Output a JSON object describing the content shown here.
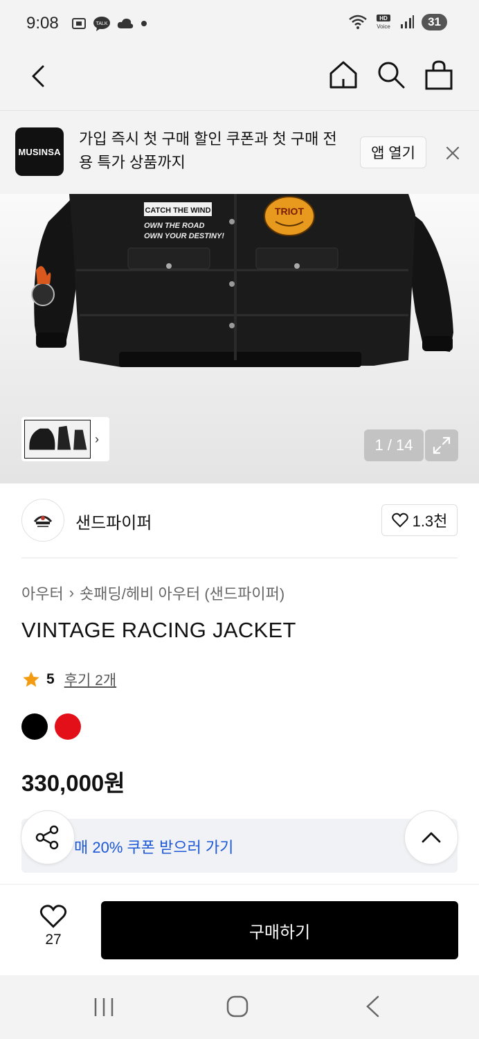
{
  "status_bar": {
    "time": "9:08",
    "battery": "31"
  },
  "banner": {
    "logo_text": "MUSINSA",
    "message": "가입 즉시 첫 구매 할인 쿠폰과 첫 구매 전용 특가 상품까지",
    "open_app_label": "앱 열기"
  },
  "gallery": {
    "counter": "1 / 14",
    "patch_text_1": "CATCH THE WIND",
    "patch_text_2": "OWN THE ROAD",
    "patch_text_3": "OWN YOUR DESTINY!",
    "patch_text_4": "TRIOT"
  },
  "brand": {
    "name": "샌드파이퍼",
    "likes": "1.3천"
  },
  "product": {
    "breadcrumb": [
      "아우터",
      "숏패딩/헤비 아우터 (샌드파이퍼)"
    ],
    "title": "VINTAGE RACING JACKET",
    "rating": "5",
    "reviews": "후기 2개",
    "colors": [
      "#000000",
      "#e3101a"
    ],
    "price": "330,000원",
    "coupon_text": "매 20% 쿠폰 받으러 가기"
  },
  "bottom": {
    "wish_count": "27",
    "buy_label": "구매하기"
  }
}
